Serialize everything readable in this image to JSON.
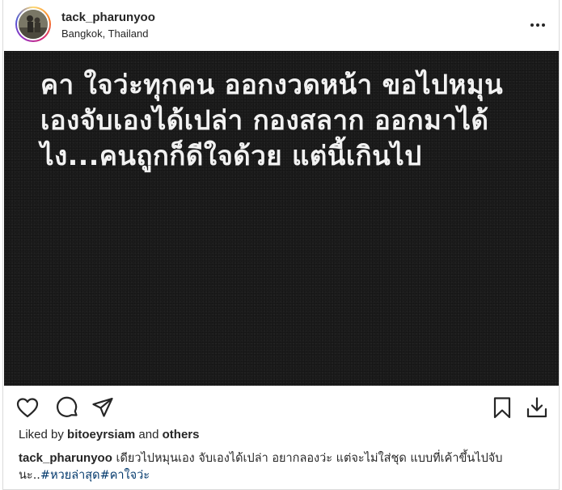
{
  "post": {
    "username": "tack_pharunyoo",
    "location": "Bangkok, Thailand",
    "media_lines": [
      "คา ใจว่ะทุกคน ออกงวดหน้า ขอไปหมุน",
      "เองจับเองได้เปล่า กองสลาก ออกมาได้",
      "ไง...คนถูกก็ดีใจด้วย แต่นี้เกินไป"
    ],
    "likes": {
      "prefix": "Liked by",
      "user": "bitoeyrsiam",
      "and": "and",
      "others": "others"
    },
    "caption": {
      "username": "tack_pharunyoo",
      "text": "เดียวไปหมุนเอง จับเองได้เปล่า อยากลองว่ะ แต่จะไม่ใส่ชุด แบบที่เค้าขึ้นไปจับ นะ..",
      "tag1": "#หวยล่าสุด",
      "tag2": "#คาใจว่ะ"
    }
  },
  "icons": {
    "more": "more-options-icon",
    "like": "heart-icon",
    "comment": "comment-icon",
    "share": "share-icon",
    "save": "bookmark-icon",
    "download": "download-icon"
  },
  "colors": {
    "text": "#262626",
    "link": "#00376b",
    "media_bg": "#1c1c1c",
    "border": "#dbdbdb"
  }
}
